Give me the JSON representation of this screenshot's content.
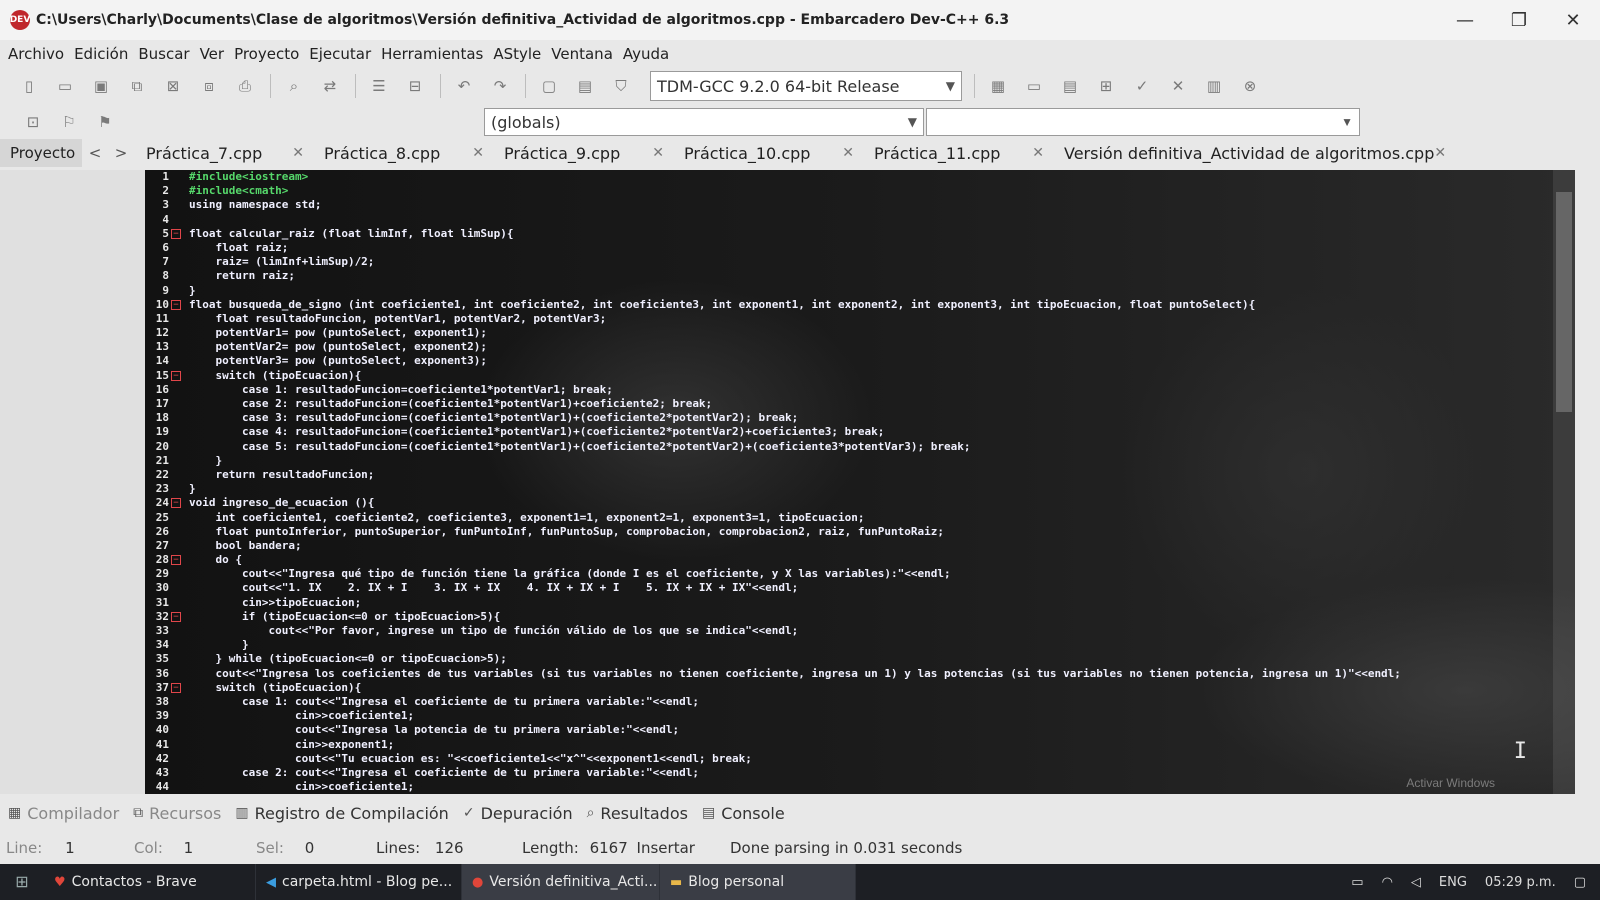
{
  "window": {
    "title": "C:\\Users\\Charly\\Documents\\Clase de algoritmos\\Versión definitiva_Actividad de algoritmos.cpp - Embarcadero Dev-C++ 6.3",
    "logo_text": "DEV",
    "minimize": "—",
    "restore": "❐",
    "close": "✕"
  },
  "menu": [
    "Archivo",
    "Edición",
    "Buscar",
    "Ver",
    "Proyecto",
    "Ejecutar",
    "Herramientas",
    "AStyle",
    "Ventana",
    "Ayuda"
  ],
  "toolbar": {
    "compiler": "TDM-GCC 9.2.0 64-bit Release",
    "scope": "(globals)"
  },
  "tabs": {
    "project": "Proyecto",
    "prev": "<",
    "next": ">",
    "files": [
      {
        "label": "Práctica_7.cpp"
      },
      {
        "label": "Práctica_8.cpp"
      },
      {
        "label": "Práctica_9.cpp"
      },
      {
        "label": "Práctica_10.cpp"
      },
      {
        "label": "Práctica_11.cpp"
      },
      {
        "label": "Versión definitiva_Actividad de algoritmos.cpp"
      }
    ]
  },
  "code_lines": [
    "#include<iostream>",
    "#include<cmath>",
    "using namespace std;",
    "",
    "float calcular_raiz (float limInf, float limSup){",
    "    float raiz;",
    "    raiz= (limInf+limSup)/2;",
    "    return raiz;",
    "}",
    "float busqueda_de_signo (int coeficiente1, int coeficiente2, int coeficiente3, int exponent1, int exponent2, int exponent3, int tipoEcuacion, float puntoSelect){",
    "    float resultadoFuncion, potentVar1, potentVar2, potentVar3;",
    "    potentVar1= pow (puntoSelect, exponent1);",
    "    potentVar2= pow (puntoSelect, exponent2);",
    "    potentVar3= pow (puntoSelect, exponent3);",
    "    switch (tipoEcuacion){",
    "        case 1: resultadoFuncion=coeficiente1*potentVar1; break;",
    "        case 2: resultadoFuncion=(coeficiente1*potentVar1)+coeficiente2; break;",
    "        case 3: resultadoFuncion=(coeficiente1*potentVar1)+(coeficiente2*potentVar2); break;",
    "        case 4: resultadoFuncion=(coeficiente1*potentVar1)+(coeficiente2*potentVar2)+coeficiente3; break;",
    "        case 5: resultadoFuncion=(coeficiente1*potentVar1)+(coeficiente2*potentVar2)+(coeficiente3*potentVar3); break;",
    "    }",
    "    return resultadoFuncion;",
    "}",
    "void ingreso_de_ecuacion (){",
    "    int coeficiente1, coeficiente2, coeficiente3, exponent1=1, exponent2=1, exponent3=1, tipoEcuacion;",
    "    float puntoInferior, puntoSuperior, funPuntoInf, funPuntoSup, comprobacion, comprobacion2, raiz, funPuntoRaiz;",
    "    bool bandera;",
    "    do {",
    "        cout<<\"Ingresa qué tipo de función tiene la gráfica (donde I es el coeficiente, y X las variables):\"<<endl;",
    "        cout<<\"1. IX    2. IX + I    3. IX + IX    4. IX + IX + I    5. IX + IX + IX\"<<endl;",
    "        cin>>tipoEcuacion;",
    "        if (tipoEcuacion<=0 or tipoEcuacion>5){",
    "            cout<<\"Por favor, ingrese un tipo de función válido de los que se indica\"<<endl;",
    "        }",
    "    } while (tipoEcuacion<=0 or tipoEcuacion>5);",
    "    cout<<\"Ingresa los coeficientes de tus variables (si tus variables no tienen coeficiente, ingresa un 1) y las potencias (si tus variables no tienen potencia, ingresa un 1)\"<<endl;",
    "    switch (tipoEcuacion){",
    "        case 1: cout<<\"Ingresa el coeficiente de tu primera variable:\"<<endl;",
    "                cin>>coeficiente1;",
    "                cout<<\"Ingresa la potencia de tu primera variable:\"<<endl;",
    "                cin>>exponent1;",
    "                cout<<\"Tu ecuacion es: \"<<coeficiente1<<\"x^\"<<exponent1<<endl; break;",
    "        case 2: cout<<\"Ingresa el coeficiente de tu primera variable:\"<<endl;",
    "                cin>>coeficiente1;"
  ],
  "fold_lines": [
    5,
    10,
    15,
    24,
    28,
    32,
    37
  ],
  "editor": {
    "ibeam": "I",
    "watermark": "Activar Windows"
  },
  "bottom_tabs": {
    "compiler": "Compilador",
    "resources": "Recursos",
    "compile_log": "Registro de Compilación",
    "debug": "Depuración",
    "results": "Resultados",
    "console": "Console"
  },
  "status": {
    "line_label": "Line:",
    "line_value": "1",
    "col_label": "Col:",
    "col_value": "1",
    "sel_label": "Sel:",
    "sel_value": "0",
    "lines_label": "Lines:",
    "lines_value": "126",
    "length_label": "Length:",
    "length_value": "6167",
    "mode": "Insertar",
    "message": "Done parsing in 0.031 seconds"
  },
  "taskbar": {
    "items": [
      {
        "label": "Contactos - Brave",
        "icon": "brave-icon"
      },
      {
        "label": "carpeta.html - Blog pe...",
        "icon": "vscode-icon"
      },
      {
        "label": "Versión definitiva_Acti...",
        "icon": "devcpp-icon"
      },
      {
        "label": "Blog personal",
        "icon": "folder-icon"
      }
    ],
    "lang": "ENG",
    "time": "05:29 p.m."
  },
  "colors": {
    "editor_bg": "#141414",
    "preprocessor": "#56d86b",
    "keyword": "#e04a55",
    "identifier": "#f0f0ff",
    "fold_marker": "#e0464a"
  }
}
